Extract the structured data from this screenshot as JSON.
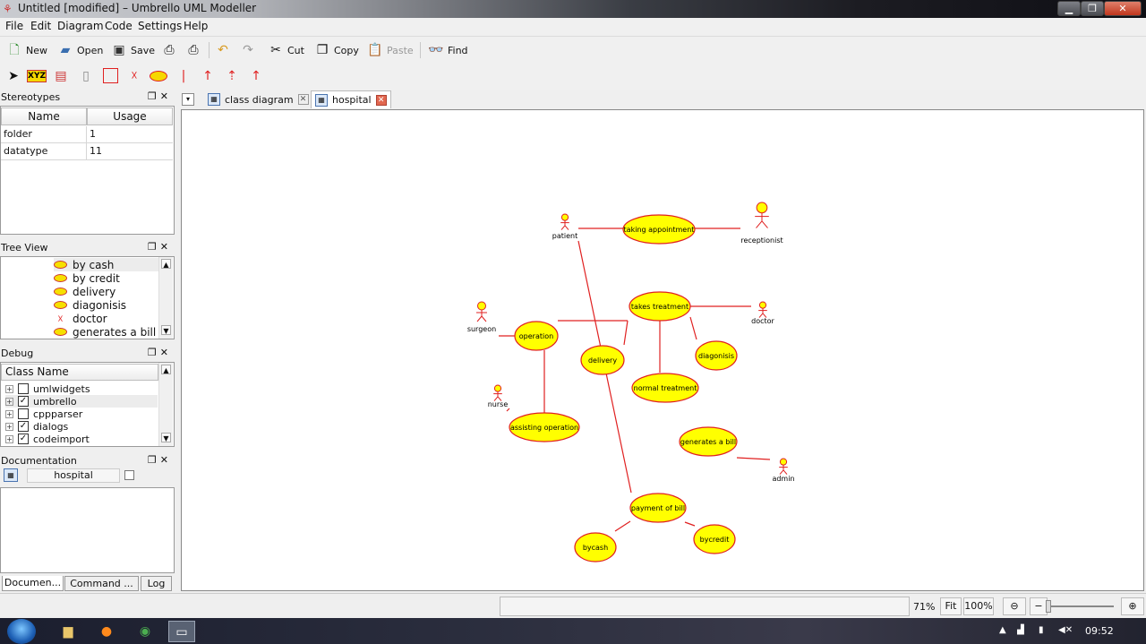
{
  "window": {
    "title": "Untitled [modified] – Umbrello UML Modeller",
    "controls": {
      "minimize": "▁",
      "maximize": "❐",
      "close": "✕"
    }
  },
  "menu": [
    "File",
    "Edit",
    "Diagram",
    "Code",
    "Settings",
    "Help"
  ],
  "toolbar": {
    "new": "New",
    "open": "Open",
    "save": "Save",
    "cut": "Cut",
    "copy": "Copy",
    "paste": "Paste",
    "find": "Find"
  },
  "stereotypes": {
    "title": "Stereotypes",
    "columns": [
      "Name",
      "Usage"
    ],
    "rows": [
      {
        "name": "folder",
        "usage": "1"
      },
      {
        "name": "datatype",
        "usage": "11"
      }
    ]
  },
  "tree_view": {
    "title": "Tree View",
    "items": [
      "by cash",
      "by credit",
      "delivery",
      "diagonisis",
      "doctor",
      "generates a bill"
    ]
  },
  "debug": {
    "title": "Debug",
    "column": "Class Name",
    "rows": [
      {
        "name": "umlwidgets",
        "checked": false
      },
      {
        "name": "umbrello",
        "checked": true
      },
      {
        "name": "cppparser",
        "checked": false
      },
      {
        "name": "dialogs",
        "checked": true
      },
      {
        "name": "codeimport",
        "checked": true
      }
    ]
  },
  "documentation": {
    "title": "Documentation",
    "name": "hospital"
  },
  "bottom_tabs": [
    "Documen...",
    "Command ...",
    "Log"
  ],
  "tabs": [
    {
      "label": "class diagram"
    },
    {
      "label": "hospital",
      "active": true
    }
  ],
  "diagram": {
    "actors": [
      "patient",
      "receptionist",
      "surgeon",
      "doctor",
      "nurse",
      "admin"
    ],
    "use_cases": [
      "taking appointment",
      "takes treatment",
      "operation",
      "delivery",
      "diagonisis",
      "normal treatment",
      "assisting operation",
      "generates a bill",
      "payment of bill",
      "bycash",
      "bycredit"
    ]
  },
  "status": {
    "zoom": "71%",
    "fit": "Fit",
    "full": "100%"
  },
  "taskbar": {
    "clock": "09:52"
  },
  "colors": {
    "use_case_fill": "#ffff00",
    "use_case_stroke": "#e02020",
    "line": "#e02020"
  }
}
